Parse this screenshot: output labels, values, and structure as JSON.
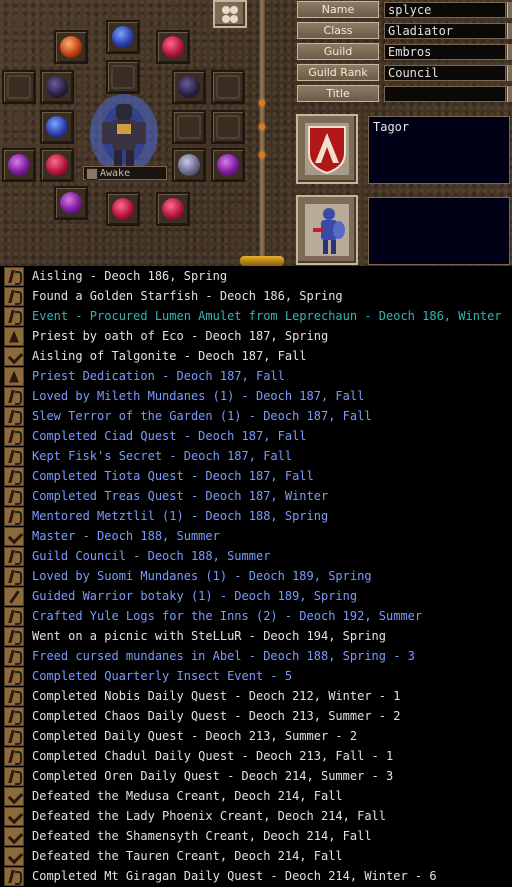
{
  "profile": {
    "fields": [
      {
        "label": "Name",
        "value": "splyce"
      },
      {
        "label": "Class",
        "value": "Gladiator"
      },
      {
        "label": "Guild",
        "value": "Embros"
      },
      {
        "label": "Guild Rank",
        "value": "Council"
      },
      {
        "label": "Title",
        "value": ""
      }
    ],
    "character_tag": "Awake",
    "note_top": "Tagor",
    "note_bottom": ""
  },
  "colors": {
    "white": "#e6e2da",
    "blue": "#7a9bff",
    "teal": "#33b5b0"
  },
  "legend": [
    {
      "icon": "scroll",
      "text": "Aisling - Deoch 186, Spring",
      "color": "white"
    },
    {
      "icon": "scroll",
      "text": "Found a Golden Starfish - Deoch 186, Spring",
      "color": "white"
    },
    {
      "icon": "scroll",
      "text": "Event - Procured Lumen Amulet from Leprechaun - Deoch 186, Winter",
      "color": "teal"
    },
    {
      "icon": "cloak",
      "text": "Priest by oath of Eco - Deoch 187, Spring",
      "color": "white"
    },
    {
      "icon": "check",
      "text": "Aisling of Talgonite - Deoch 187, Fall",
      "color": "white"
    },
    {
      "icon": "cloak",
      "text": "Priest Dedication - Deoch 187, Fall",
      "color": "blue"
    },
    {
      "icon": "scroll",
      "text": "Loved by Mileth Mundanes (1) - Deoch 187, Fall",
      "color": "blue"
    },
    {
      "icon": "scroll",
      "text": "Slew Terror of the Garden (1) - Deoch 187, Fall",
      "color": "blue"
    },
    {
      "icon": "scroll",
      "text": "Completed Ciad Quest - Deoch 187, Fall",
      "color": "blue"
    },
    {
      "icon": "scroll",
      "text": "Kept Fisk's Secret - Deoch 187, Fall",
      "color": "blue"
    },
    {
      "icon": "scroll",
      "text": "Completed Tiota Quest - Deoch 187, Fall",
      "color": "blue"
    },
    {
      "icon": "scroll",
      "text": "Completed Treas Quest - Deoch 187, Winter",
      "color": "blue"
    },
    {
      "icon": "scroll",
      "text": "Mentored Metztlil (1) - Deoch 188, Spring",
      "color": "blue"
    },
    {
      "icon": "check",
      "text": "Master - Deoch 188, Summer",
      "color": "blue"
    },
    {
      "icon": "scroll",
      "text": "Guild Council - Deoch 188, Summer",
      "color": "blue"
    },
    {
      "icon": "scroll",
      "text": "Loved by Suomi Mundanes (1) - Deoch 189, Spring",
      "color": "blue"
    },
    {
      "icon": "sword",
      "text": "Guided Warrior botaky (1) - Deoch 189, Spring",
      "color": "blue"
    },
    {
      "icon": "scroll",
      "text": "Crafted Yule Logs for the Inns (2) - Deoch 192, Summer",
      "color": "blue"
    },
    {
      "icon": "scroll",
      "text": "Went on a picnic with SteLLuR - Deoch 194, Spring",
      "color": "white"
    },
    {
      "icon": "scroll",
      "text": "Freed cursed mundanes in Abel - Deoch 188, Spring - 3",
      "color": "blue"
    },
    {
      "icon": "scroll",
      "text": "Completed Quarterly Insect Event - 5",
      "color": "blue"
    },
    {
      "icon": "scroll",
      "text": "Completed Nobis Daily Quest - Deoch 212, Winter - 1",
      "color": "white"
    },
    {
      "icon": "scroll",
      "text": "Completed Chaos Daily Quest - Deoch 213, Summer - 2",
      "color": "white"
    },
    {
      "icon": "scroll",
      "text": "Completed Daily Quest - Deoch 213, Summer - 2",
      "color": "white"
    },
    {
      "icon": "scroll",
      "text": "Completed Chadul Daily Quest - Deoch 213, Fall - 1",
      "color": "white"
    },
    {
      "icon": "scroll",
      "text": "Completed Oren Daily Quest - Deoch 214, Summer - 3",
      "color": "white"
    },
    {
      "icon": "check",
      "text": "Defeated the Medusa Creant, Deoch 214, Fall",
      "color": "white"
    },
    {
      "icon": "check",
      "text": "Defeated the Lady Phoenix Creant, Deoch 214, Fall",
      "color": "white"
    },
    {
      "icon": "check",
      "text": "Defeated the Shamensyth Creant, Deoch 214, Fall",
      "color": "white"
    },
    {
      "icon": "check",
      "text": "Defeated the Tauren Creant, Deoch 214, Fall",
      "color": "white"
    },
    {
      "icon": "scroll",
      "text": "Completed Mt Giragan Daily Quest - Deoch 214, Winter - 6",
      "color": "white"
    }
  ]
}
